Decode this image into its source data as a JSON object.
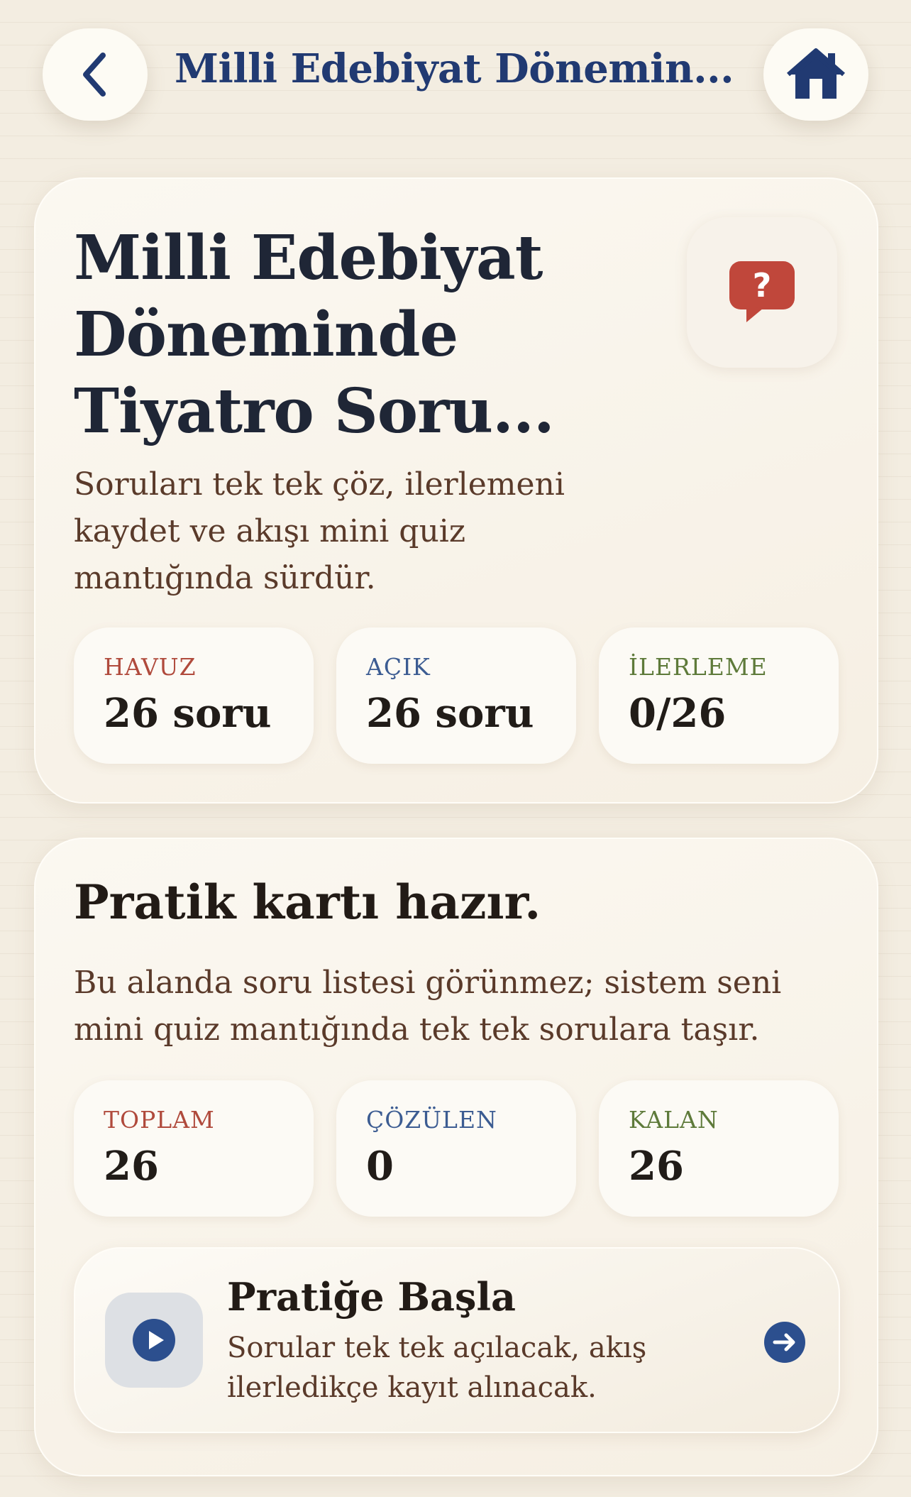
{
  "topbar": {
    "title": "Milli Edebiyat Dönemin...",
    "back_icon": "chevron-left-icon",
    "home_icon": "home-icon"
  },
  "hero": {
    "title": "Milli Edebiyat Döneminde Tiyatro Soru...",
    "subtitle": "Soruları tek tek çöz, ilerlemeni kaydet ve akışı mini quiz mantığında sürdür.",
    "icon": "question-bubble-icon",
    "stats": [
      {
        "label": "HAVUZ",
        "value": "26 soru"
      },
      {
        "label": "AÇIK",
        "value": "26 soru"
      },
      {
        "label": "İLERLEME",
        "value": "0/26"
      }
    ]
  },
  "practice": {
    "title": "Pratik kartı hazır.",
    "subtitle": "Bu alanda soru listesi görünmez; sistem seni mini quiz mantığında tek tek sorulara taşır.",
    "stats": [
      {
        "label": "TOPLAM",
        "value": "26"
      },
      {
        "label": "ÇÖZÜLEN",
        "value": "0"
      },
      {
        "label": "KALAN",
        "value": "26"
      }
    ],
    "cta": {
      "title": "Pratiğe Başla",
      "subtitle": "Sorular tek tek açılacak, akış ilerledikçe kayıt alınacak.",
      "icon": "play-icon",
      "arrow_icon": "arrow-right-icon"
    }
  },
  "colors": {
    "accent_navy": "#213a72",
    "label_red": "#b04a3c",
    "label_blue": "#3c5c92",
    "label_green": "#5e7a3a",
    "question_icon": "#c0473b",
    "background": "#f3ede1"
  }
}
